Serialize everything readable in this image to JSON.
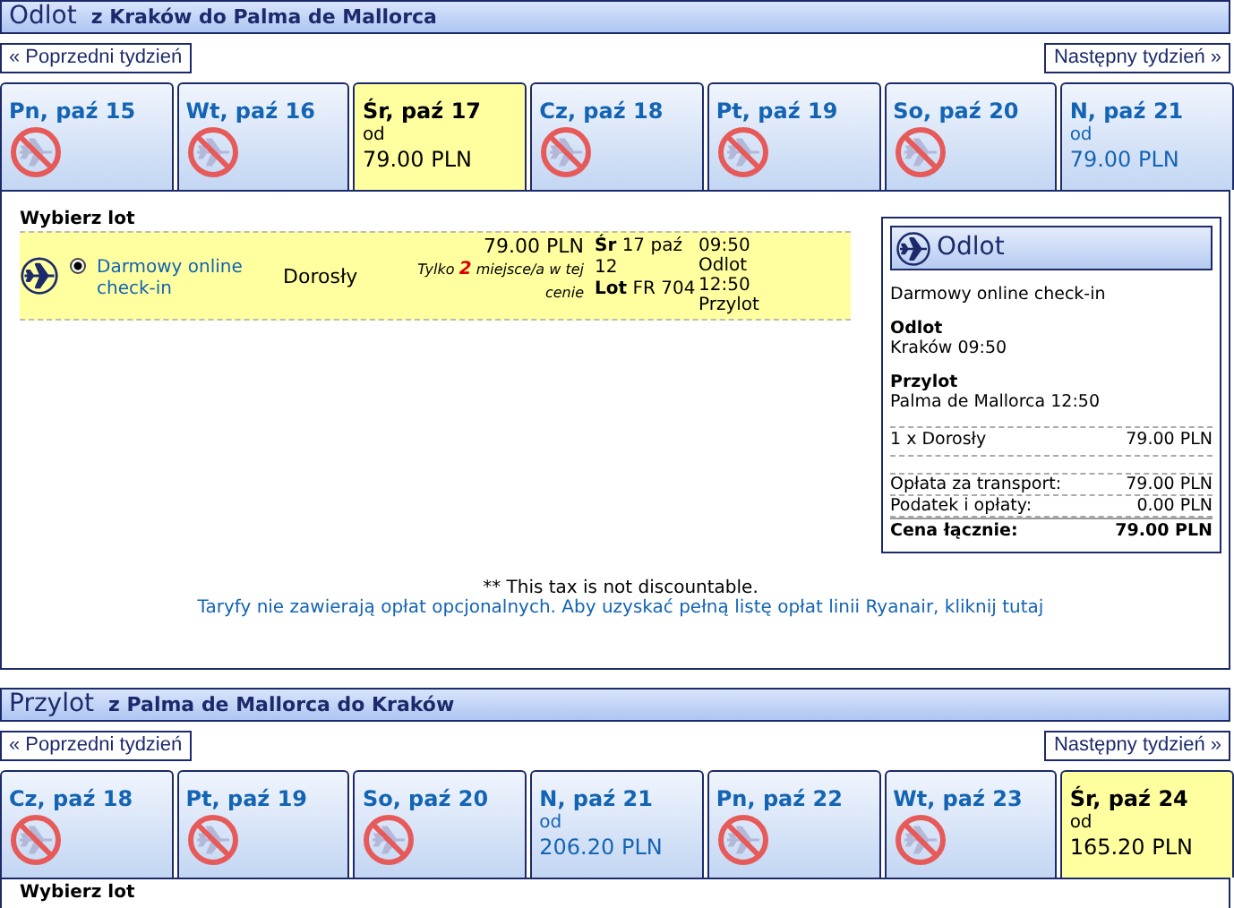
{
  "sections": [
    {
      "title": "Odlot",
      "route": "z Kraków do Palma de Mallorca",
      "prev": "« Poprzedni tydzień",
      "next": "Następny tydzień »",
      "days": [
        {
          "label": "Pn, paź 15",
          "selected": false,
          "available": false
        },
        {
          "label": "Wt, paź 16",
          "selected": false,
          "available": false
        },
        {
          "label": "Śr, paź 17",
          "selected": true,
          "available": true,
          "from": "od",
          "price": "79.00 PLN"
        },
        {
          "label": "Cz, paź 18",
          "selected": false,
          "available": false
        },
        {
          "label": "Pt, paź 19",
          "selected": false,
          "available": false
        },
        {
          "label": "So, paź 20",
          "selected": false,
          "available": false
        },
        {
          "label": "N, paź 21",
          "selected": false,
          "available": true,
          "from": "od",
          "price": "79.00 PLN"
        }
      ],
      "select_label": "Wybierz lot",
      "flights": [
        {
          "selected": true,
          "fare": "Darmowy online check-in",
          "passenger": "Dorosły",
          "price": "79.00 PLN",
          "note": "Tylko **2** miejsce/a w tej cenie",
          "date": "**Śr** 17 paź 12",
          "flight": "**Lot** FR 704",
          "dep_time": "09:50",
          "dep_label": "Odlot",
          "arr_time": "12:50",
          "arr_label": "Przylot"
        }
      ],
      "summary": {
        "title": "Odlot",
        "fare": "Darmowy online check-in",
        "dep_label": "Odlot",
        "dep_value": "Kraków 09:50",
        "arr_label": "Przylot",
        "arr_value": "Palma de Mallorca 12:50",
        "lines": [
          {
            "label": "1 x Dorosły",
            "value": "79.00 PLN"
          }
        ],
        "charges": [
          {
            "label": "Opłata za transport:",
            "value": "79.00 PLN"
          },
          {
            "label": "Podatek i opłaty:",
            "value": "0.00 PLN"
          }
        ],
        "total": {
          "label": "Cena łącznie:",
          "value": "79.00 PLN"
        }
      },
      "footnote": "** This tax is not discountable.",
      "link": "Taryfy nie zawierają opłat opcjonalnych. Aby uzyskać pełną listę opłat linii Ryanair, kliknij tutaj"
    },
    {
      "title": "Przylot",
      "route": "z Palma de Mallorca do Kraków",
      "prev": "« Poprzedni tydzień",
      "next": "Następny tydzień »",
      "days": [
        {
          "label": "Cz, paź 18",
          "selected": false,
          "available": false
        },
        {
          "label": "Pt, paź 19",
          "selected": false,
          "available": false
        },
        {
          "label": "So, paź 20",
          "selected": false,
          "available": false
        },
        {
          "label": "N, paź 21",
          "selected": false,
          "available": true,
          "from": "od",
          "price": "206.20 PLN"
        },
        {
          "label": "Pn, paź 22",
          "selected": false,
          "available": false
        },
        {
          "label": "Wt, paź 23",
          "selected": false,
          "available": false
        },
        {
          "label": "Śr, paź 24",
          "selected": true,
          "available": true,
          "from": "od",
          "price": "165.20 PLN"
        }
      ],
      "select_label": "Wybierz lot"
    }
  ]
}
